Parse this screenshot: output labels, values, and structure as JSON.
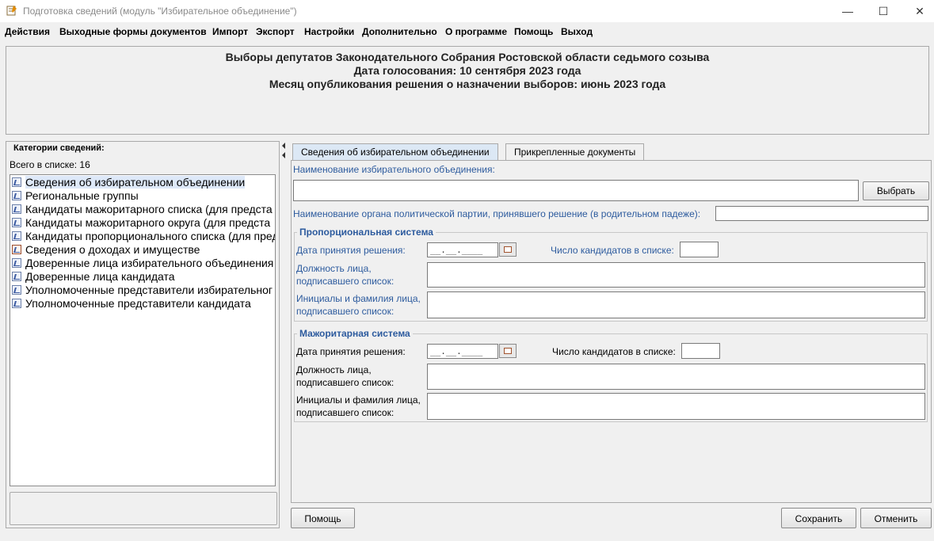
{
  "window": {
    "title": "Подготовка сведений (модуль \"Избирательное объединение\")",
    "minimize_glyph": "—",
    "maximize_glyph": "☐",
    "close_glyph": "✕"
  },
  "menu": {
    "items": [
      "Действия",
      "Выходные формы документов",
      "Импорт",
      "Экспорт",
      "Настройки",
      "Дополнительно",
      "О программе",
      "Помощь",
      "Выход"
    ]
  },
  "header": {
    "line1": "Выборы депутатов Законодательного Собрания Ростовской области седьмого созыва",
    "line2": "Дата голосования: 10 сентября 2023 года",
    "line3": "Месяц опубликования решения о назначении выборов: июнь 2023 года"
  },
  "left_panel": {
    "title": "Категории сведений:",
    "count_label": "Всего в списке:  16",
    "items": [
      {
        "label": "Сведения об избирательном объединении",
        "icon": "form-icon"
      },
      {
        "label": "Региональные группы",
        "icon": "form-icon"
      },
      {
        "label": "Кандидаты мажоритарного списка (для предста",
        "icon": "form-icon"
      },
      {
        "label": "Кандидаты мажоритарного округа (для предста",
        "icon": "form-icon"
      },
      {
        "label": "Кандидаты пропорционального списка (для пред",
        "icon": "form-icon"
      },
      {
        "label": "Сведения о доходах и имуществе",
        "icon": "document-icon"
      },
      {
        "label": "Доверенные лица избирательного объединения",
        "icon": "form-icon"
      },
      {
        "label": "Доверенные лица кандидата",
        "icon": "form-icon"
      },
      {
        "label": "Уполномоченные представители избирательног",
        "icon": "form-icon"
      },
      {
        "label": "Уполномоченные представители кандидата",
        "icon": "form-icon"
      }
    ]
  },
  "tabs": [
    "Сведения об избирательном объединении",
    "Прикрепленные документы"
  ],
  "form": {
    "org_name_label": "Наименование избирательного объединения:",
    "org_name_value": "",
    "choose_button": "Выбрать",
    "party_body_label": "Наименование органа политической партии, принявшего решение (в родительном падеже):",
    "party_body_value": "",
    "proportional": {
      "title": "Пропорциональная система",
      "date_label": "Дата принятия решения:",
      "date_value": "__.__.____",
      "count_label": "Число кандидатов в списке:",
      "count_value": "",
      "position_label_1": "Должность лица,",
      "position_label_2": "подписавшего список:",
      "initials_label_1": "Инициалы и фамилия лица,",
      "initials_label_2": "подписавшего список:"
    },
    "majoritarian": {
      "title": "Мажоритарная система",
      "date_label": "Дата принятия решения:",
      "date_value": "__.__.____",
      "count_label": "Число кандидатов в списке:",
      "count_value": "",
      "position_label_1": "Должность лица,",
      "position_label_2": "подписавшего список:",
      "initials_label_1": "Инициалы и фамилия лица,",
      "initials_label_2": "подписавшего список:"
    }
  },
  "buttons": {
    "help": "Помощь",
    "save": "Сохранить",
    "cancel": "Отменить"
  }
}
